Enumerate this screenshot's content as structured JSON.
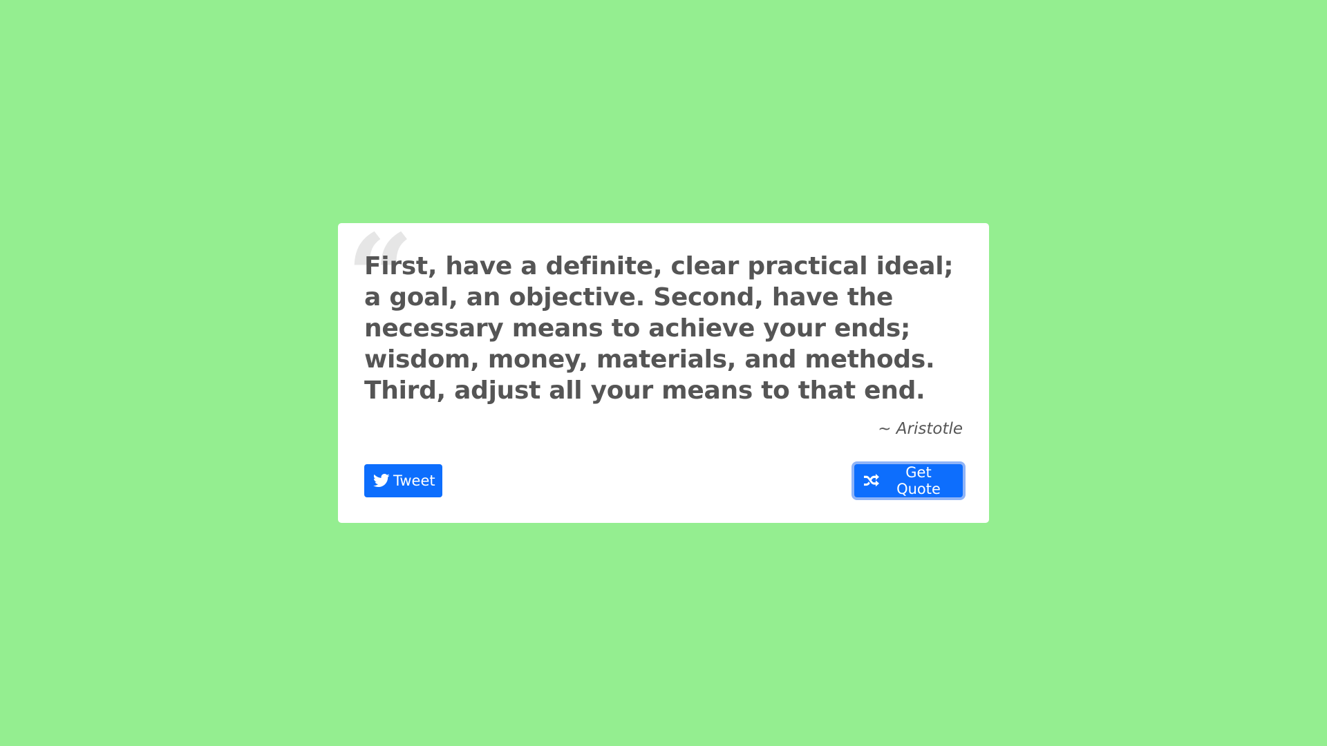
{
  "colors": {
    "background": "#94ee90",
    "card": "#ffffff",
    "text": "#555555",
    "button": "#0d6efd",
    "focus_ring": "#8fb4f7"
  },
  "quote": {
    "mark": "“",
    "text": "First, have a definite, clear practical ideal; a goal, an objective. Second, have the necessary means to achieve your ends; wisdom, money, materials, and methods. Third, adjust all your means to that end.",
    "author": "~ Aristotle"
  },
  "buttons": {
    "tweet": {
      "label": "Tweet",
      "icon": "twitter-icon"
    },
    "get_quote": {
      "label": "Get Quote",
      "icon": "shuffle-icon"
    }
  }
}
